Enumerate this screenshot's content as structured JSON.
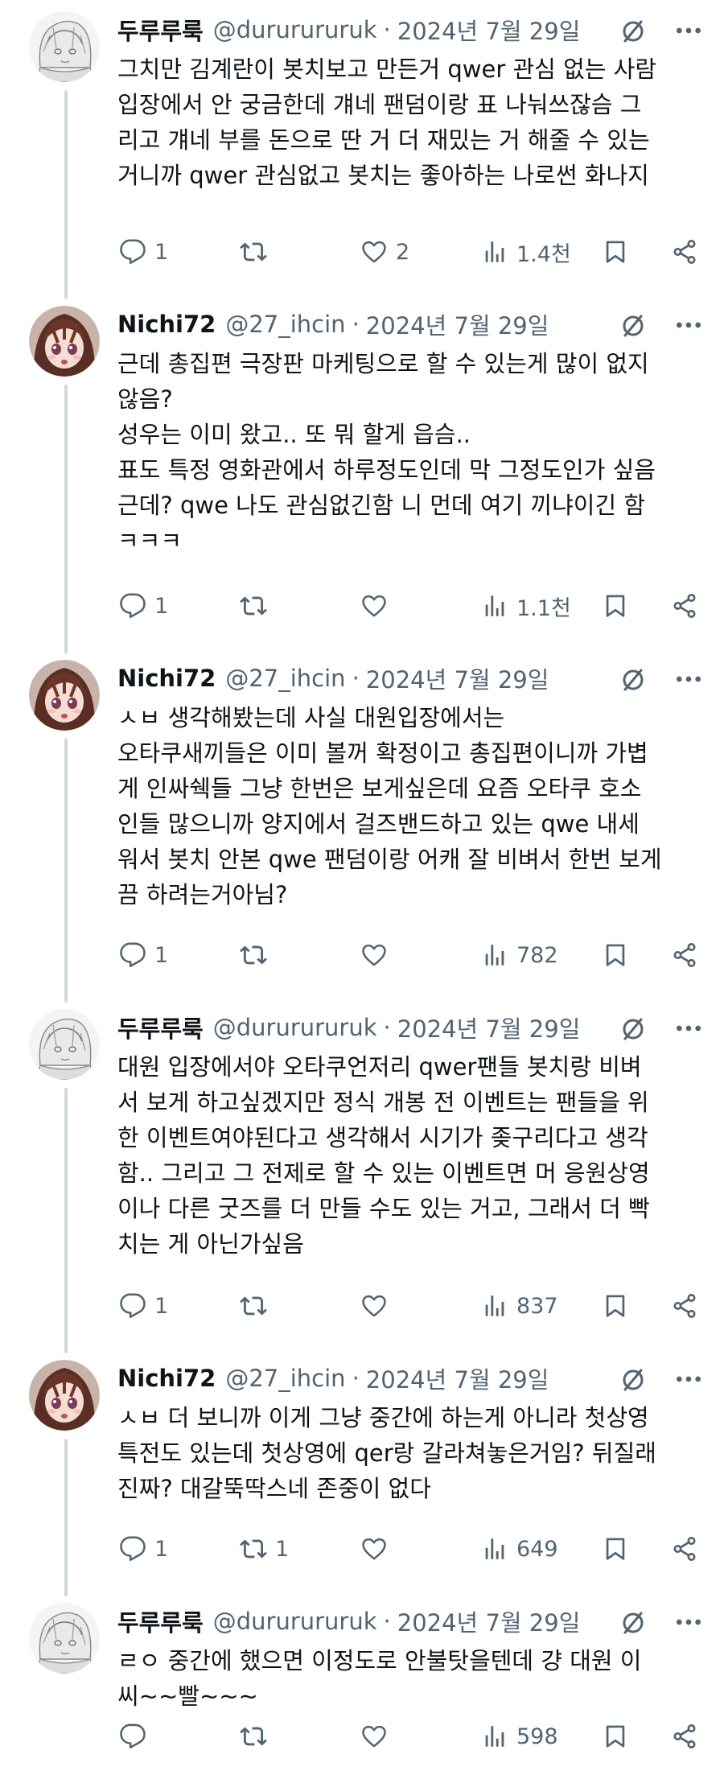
{
  "tweets": [
    {
      "name": "두루루룩",
      "handle": "@dururururuk",
      "sep": "·",
      "date": "2024년 7월 29일",
      "text": "그치만 김계란이 봇치보고 만든거 qwer 관심 없는 사람\n입장에서 안 궁금한데 걔네 팬덤이랑 표 나눠쓰잖슴 그\n리고 걔네 부를 돈으로 딴 거 더 재밌는 거 해줄 수 있는\n거니까 qwer 관심없고 봇치는 좋아하는 나로썬 화나지",
      "replies": "1",
      "reposts": "",
      "likes": "2",
      "views": "1.4천"
    },
    {
      "name": "Nichi72",
      "handle": "@27_ihcin",
      "sep": "·",
      "date": "2024년 7월 29일",
      "text": "근데 총집편 극장판 마케팅으로 할 수 있는게 많이 없지\n않음?\n성우는 이미 왔고.. 또 뭐 할게 읍슴..\n표도 특정 영화관에서 하루정도인데 막 그정도인가 싶음\n근데? qwe 나도 관심없긴함 니 먼데 여기 끼냐이긴 함\nㅋㅋㅋ",
      "replies": "1",
      "reposts": "",
      "likes": "",
      "views": "1.1천"
    },
    {
      "name": "Nichi72",
      "handle": "@27_ihcin",
      "sep": "·",
      "date": "2024년 7월 29일",
      "text": "ㅅㅂ 생각해봤는데 사실 대원입장에서는\n오타쿠새끼들은 이미 볼꺼 확정이고 총집편이니까 가볍\n게 인싸쉑들 그냥 한번은 보게싶은데 요즘 오타쿠 호소\n인들 많으니까 양지에서 걸즈밴드하고 있는 qwe 내세\n워서 봇치 안본 qwe 팬덤이랑 어캐 잘 비벼서 한번 보게\n끔 하려는거아님?",
      "replies": "1",
      "reposts": "",
      "likes": "",
      "views": "782"
    },
    {
      "name": "두루루룩",
      "handle": "@dururururuk",
      "sep": "·",
      "date": "2024년 7월 29일",
      "text": "대원 입장에서야 오타쿠언저리 qwer팬들 봇치랑 비벼\n서 보게 하고싶겠지만 정식 개봉 전 이벤트는 팬들을 위\n한 이벤트여야된다고 생각해서 시기가 좆구리다고 생각\n함.. 그리고 그 전제로 할 수 있는 이벤트면 머 응원상영\n이나 다른 굿즈를 더 만들 수도 있는 거고, 그래서 더 빡\n치는 게 아닌가싶음",
      "replies": "1",
      "reposts": "",
      "likes": "",
      "views": "837"
    },
    {
      "name": "Nichi72",
      "handle": "@27_ihcin",
      "sep": "·",
      "date": "2024년 7월 29일",
      "text": "ㅅㅂ 더 보니까 이게 그냥 중간에 하는게 아니라 첫상영\n특전도 있는데 첫상영에 qer랑 갈라쳐놓은거임? 뒤질래\n진짜? 대갈뚝딱스네 존중이 없다",
      "replies": "1",
      "reposts": "1",
      "likes": "",
      "views": "649"
    },
    {
      "name": "두루루룩",
      "handle": "@dururururuk",
      "sep": "·",
      "date": "2024년 7월 29일",
      "text": "ㄹㅇ 중간에 했으면 이정도로 안불탓을텐데 걍 대원 이\n씨~~빨~~~",
      "replies": "",
      "reposts": "",
      "likes": "",
      "views": "598"
    }
  ],
  "icons": {
    "grok": "grok-slash-icon",
    "more": "more-dots-icon",
    "reply": "reply-icon",
    "repost": "repost-icon",
    "like": "like-icon",
    "views": "views-icon",
    "bookmark": "bookmark-icon",
    "share": "share-icon"
  },
  "colors": {
    "text": "#0f1419",
    "muted": "#536471",
    "line": "#cfd9de"
  }
}
